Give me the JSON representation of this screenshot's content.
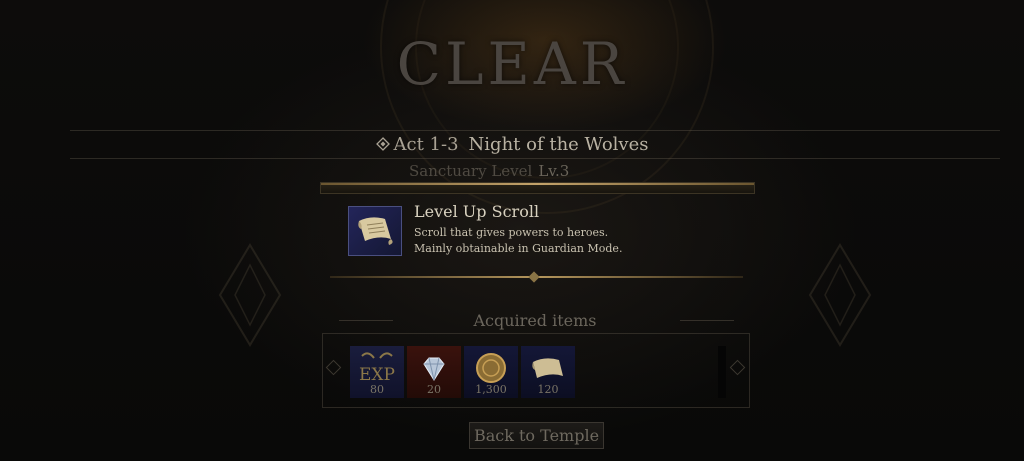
{
  "result": {
    "title": "CLEAR"
  },
  "stage": {
    "act": "Act 1-3",
    "name": "Night of the Wolves",
    "sanctuary_label": "Sanctuary Level",
    "sanctuary_level": "Lv.3"
  },
  "featured_item": {
    "name": "Level Up Scroll",
    "description_lines": [
      "Scroll that gives powers to heroes.",
      "Mainly obtainable in Guardian Mode."
    ],
    "icon": "scroll-icon"
  },
  "acquired": {
    "title": "Acquired items",
    "items": [
      {
        "icon": "exp-icon",
        "label": "EXP",
        "count": "80"
      },
      {
        "icon": "diamond-icon",
        "count": "20"
      },
      {
        "icon": "gold-coin-icon",
        "count": "1,300"
      },
      {
        "icon": "scroll-icon",
        "count": "120"
      }
    ]
  },
  "buttons": {
    "back": "Back to Temple"
  },
  "colors": {
    "gold": "#b5965c",
    "panel_blue": "#1a1d3d",
    "panel_red": "#3a120d"
  }
}
